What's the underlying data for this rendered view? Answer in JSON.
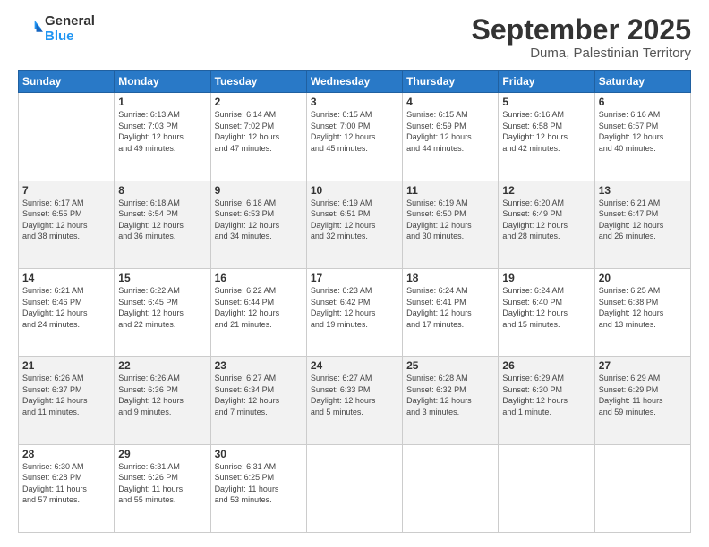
{
  "logo": {
    "general": "General",
    "blue": "Blue"
  },
  "title": {
    "month": "September 2025",
    "location": "Duma, Palestinian Territory"
  },
  "days_of_week": [
    "Sunday",
    "Monday",
    "Tuesday",
    "Wednesday",
    "Thursday",
    "Friday",
    "Saturday"
  ],
  "weeks": [
    [
      {
        "num": "",
        "info": ""
      },
      {
        "num": "1",
        "info": "Sunrise: 6:13 AM\nSunset: 7:03 PM\nDaylight: 12 hours\nand 49 minutes."
      },
      {
        "num": "2",
        "info": "Sunrise: 6:14 AM\nSunset: 7:02 PM\nDaylight: 12 hours\nand 47 minutes."
      },
      {
        "num": "3",
        "info": "Sunrise: 6:15 AM\nSunset: 7:00 PM\nDaylight: 12 hours\nand 45 minutes."
      },
      {
        "num": "4",
        "info": "Sunrise: 6:15 AM\nSunset: 6:59 PM\nDaylight: 12 hours\nand 44 minutes."
      },
      {
        "num": "5",
        "info": "Sunrise: 6:16 AM\nSunset: 6:58 PM\nDaylight: 12 hours\nand 42 minutes."
      },
      {
        "num": "6",
        "info": "Sunrise: 6:16 AM\nSunset: 6:57 PM\nDaylight: 12 hours\nand 40 minutes."
      }
    ],
    [
      {
        "num": "7",
        "info": "Sunrise: 6:17 AM\nSunset: 6:55 PM\nDaylight: 12 hours\nand 38 minutes."
      },
      {
        "num": "8",
        "info": "Sunrise: 6:18 AM\nSunset: 6:54 PM\nDaylight: 12 hours\nand 36 minutes."
      },
      {
        "num": "9",
        "info": "Sunrise: 6:18 AM\nSunset: 6:53 PM\nDaylight: 12 hours\nand 34 minutes."
      },
      {
        "num": "10",
        "info": "Sunrise: 6:19 AM\nSunset: 6:51 PM\nDaylight: 12 hours\nand 32 minutes."
      },
      {
        "num": "11",
        "info": "Sunrise: 6:19 AM\nSunset: 6:50 PM\nDaylight: 12 hours\nand 30 minutes."
      },
      {
        "num": "12",
        "info": "Sunrise: 6:20 AM\nSunset: 6:49 PM\nDaylight: 12 hours\nand 28 minutes."
      },
      {
        "num": "13",
        "info": "Sunrise: 6:21 AM\nSunset: 6:47 PM\nDaylight: 12 hours\nand 26 minutes."
      }
    ],
    [
      {
        "num": "14",
        "info": "Sunrise: 6:21 AM\nSunset: 6:46 PM\nDaylight: 12 hours\nand 24 minutes."
      },
      {
        "num": "15",
        "info": "Sunrise: 6:22 AM\nSunset: 6:45 PM\nDaylight: 12 hours\nand 22 minutes."
      },
      {
        "num": "16",
        "info": "Sunrise: 6:22 AM\nSunset: 6:44 PM\nDaylight: 12 hours\nand 21 minutes."
      },
      {
        "num": "17",
        "info": "Sunrise: 6:23 AM\nSunset: 6:42 PM\nDaylight: 12 hours\nand 19 minutes."
      },
      {
        "num": "18",
        "info": "Sunrise: 6:24 AM\nSunset: 6:41 PM\nDaylight: 12 hours\nand 17 minutes."
      },
      {
        "num": "19",
        "info": "Sunrise: 6:24 AM\nSunset: 6:40 PM\nDaylight: 12 hours\nand 15 minutes."
      },
      {
        "num": "20",
        "info": "Sunrise: 6:25 AM\nSunset: 6:38 PM\nDaylight: 12 hours\nand 13 minutes."
      }
    ],
    [
      {
        "num": "21",
        "info": "Sunrise: 6:26 AM\nSunset: 6:37 PM\nDaylight: 12 hours\nand 11 minutes."
      },
      {
        "num": "22",
        "info": "Sunrise: 6:26 AM\nSunset: 6:36 PM\nDaylight: 12 hours\nand 9 minutes."
      },
      {
        "num": "23",
        "info": "Sunrise: 6:27 AM\nSunset: 6:34 PM\nDaylight: 12 hours\nand 7 minutes."
      },
      {
        "num": "24",
        "info": "Sunrise: 6:27 AM\nSunset: 6:33 PM\nDaylight: 12 hours\nand 5 minutes."
      },
      {
        "num": "25",
        "info": "Sunrise: 6:28 AM\nSunset: 6:32 PM\nDaylight: 12 hours\nand 3 minutes."
      },
      {
        "num": "26",
        "info": "Sunrise: 6:29 AM\nSunset: 6:30 PM\nDaylight: 12 hours\nand 1 minute."
      },
      {
        "num": "27",
        "info": "Sunrise: 6:29 AM\nSunset: 6:29 PM\nDaylight: 11 hours\nand 59 minutes."
      }
    ],
    [
      {
        "num": "28",
        "info": "Sunrise: 6:30 AM\nSunset: 6:28 PM\nDaylight: 11 hours\nand 57 minutes."
      },
      {
        "num": "29",
        "info": "Sunrise: 6:31 AM\nSunset: 6:26 PM\nDaylight: 11 hours\nand 55 minutes."
      },
      {
        "num": "30",
        "info": "Sunrise: 6:31 AM\nSunset: 6:25 PM\nDaylight: 11 hours\nand 53 minutes."
      },
      {
        "num": "",
        "info": ""
      },
      {
        "num": "",
        "info": ""
      },
      {
        "num": "",
        "info": ""
      },
      {
        "num": "",
        "info": ""
      }
    ]
  ]
}
